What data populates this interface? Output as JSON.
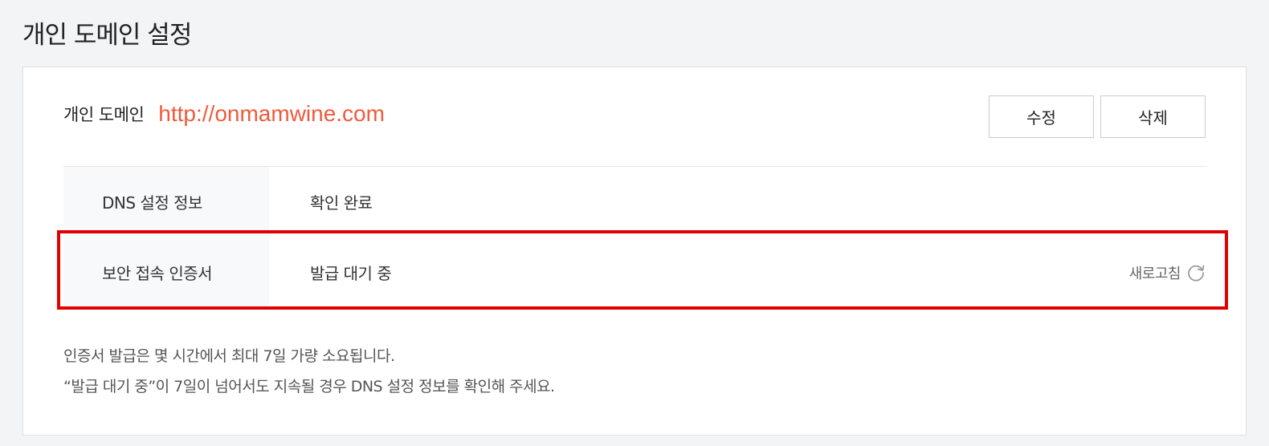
{
  "page": {
    "title": "개인 도메인 설정"
  },
  "domain": {
    "label": "개인 도메인",
    "url": "http://onmamwine.com",
    "edit_label": "수정",
    "delete_label": "삭제"
  },
  "rows": [
    {
      "label": "DNS 설정 정보",
      "value": "확인 완료"
    },
    {
      "label": "보안 접속 인증서",
      "value": "발급 대기 중",
      "action_label": "새로고침",
      "action_icon": "refresh-icon"
    }
  ],
  "notes": [
    "인증서 발급은 몇 시간에서 최대 7일 가량 소요됩니다.",
    "“발급 대기 중”이 7일이 넘어서도 지속될 경우 DNS 설정 정보를 확인해 주세요."
  ],
  "colors": {
    "accent": "#ef5a3c",
    "highlight": "#e00000",
    "row_header_bg": "#f8f9fb",
    "page_bg": "#f3f4f6"
  }
}
